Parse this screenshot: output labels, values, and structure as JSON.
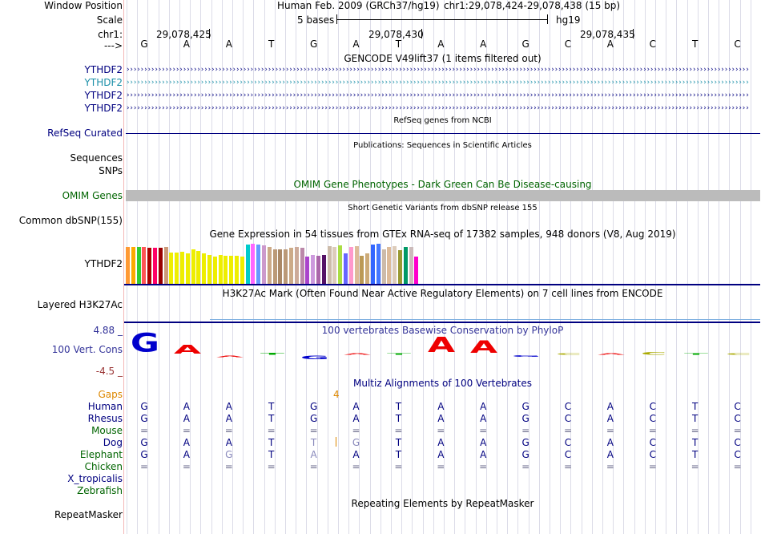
{
  "header": {
    "window_position_label": "Window Position",
    "assembly": "Human Feb. 2009 (GRCh37/hg19)",
    "range": "chr1:29,078,424-29,078,438 (15 bp)",
    "scale_label": "Scale",
    "scale_text": "5 bases",
    "db": "hg19",
    "chrom_label": "chr1:",
    "strand_label": "--->",
    "ticks": [
      "29,078,425",
      "29,078,430",
      "29,078,435"
    ]
  },
  "reference_bases": [
    "G",
    "A",
    "A",
    "T",
    "G",
    "A",
    "T",
    "A",
    "A",
    "G",
    "C",
    "A",
    "C",
    "T",
    "C"
  ],
  "gencode": {
    "title": "GENCODE V49lift37 (1 items filtered out)",
    "items": [
      "YTHDF2",
      "YTHDF2",
      "YTHDF2",
      "YTHDF2"
    ]
  },
  "refseq": {
    "title": "RefSeq genes from NCBI",
    "label": "RefSeq Curated"
  },
  "publications": {
    "title": "Publications: Sequences in Scientific Articles",
    "labels": [
      "Sequences",
      "SNPs"
    ]
  },
  "omim": {
    "title": "OMIM Gene Phenotypes - Dark Green Can Be Disease-causing",
    "label": "OMIM Genes"
  },
  "dbsnp": {
    "title": "Short Genetic Variants from dbSNP release 155",
    "label": "Common dbSNP(155)"
  },
  "gtex": {
    "title": "Gene Expression in 54 tissues from GTEx RNA-seq of 17382 samples, 948 donors (V8, Aug 2019)",
    "label": "YTHDF2",
    "bars": [
      {
        "color": "#ff9933",
        "value": 0.92
      },
      {
        "color": "#ffaa00",
        "value": 0.92
      },
      {
        "color": "#33cc33",
        "value": 0.92
      },
      {
        "color": "#ff5555",
        "value": 0.92
      },
      {
        "color": "#aa0000",
        "value": 0.9
      },
      {
        "color": "#ff0066",
        "value": 0.9
      },
      {
        "color": "#990000",
        "value": 0.9
      },
      {
        "color": "#cc9977",
        "value": 0.92
      },
      {
        "color": "#eeee00",
        "value": 0.78
      },
      {
        "color": "#eeee00",
        "value": 0.78
      },
      {
        "color": "#eeee00",
        "value": 0.8
      },
      {
        "color": "#eeee00",
        "value": 0.76
      },
      {
        "color": "#eeee00",
        "value": 0.86
      },
      {
        "color": "#eeee00",
        "value": 0.82
      },
      {
        "color": "#eeee00",
        "value": 0.76
      },
      {
        "color": "#eeee00",
        "value": 0.72
      },
      {
        "color": "#eeee00",
        "value": 0.68
      },
      {
        "color": "#eeee00",
        "value": 0.72
      },
      {
        "color": "#eeee00",
        "value": 0.7
      },
      {
        "color": "#eeee00",
        "value": 0.7
      },
      {
        "color": "#eeee00",
        "value": 0.7
      },
      {
        "color": "#eeee00",
        "value": 0.68
      },
      {
        "color": "#00cccc",
        "value": 0.98
      },
      {
        "color": "#ff66ff",
        "value": 1.0
      },
      {
        "color": "#6699ff",
        "value": 0.98
      },
      {
        "color": "#cc99cc",
        "value": 0.96
      },
      {
        "color": "#ccaa88",
        "value": 0.92
      },
      {
        "color": "#bb9977",
        "value": 0.86
      },
      {
        "color": "#aa8866",
        "value": 0.86
      },
      {
        "color": "#bb9977",
        "value": 0.86
      },
      {
        "color": "#ccaa88",
        "value": 0.9
      },
      {
        "color": "#ccaa99",
        "value": 0.92
      },
      {
        "color": "#bb88aa",
        "value": 0.9
      },
      {
        "color": "#aa44cc",
        "value": 0.68
      },
      {
        "color": "#cc99dd",
        "value": 0.72
      },
      {
        "color": "#aa66aa",
        "value": 0.7
      },
      {
        "color": "#551166",
        "value": 0.72
      },
      {
        "color": "#ccbbaa",
        "value": 0.94
      },
      {
        "color": "#ddccbb",
        "value": 0.92
      },
      {
        "color": "#aadd44",
        "value": 0.96
      },
      {
        "color": "#6666ff",
        "value": 0.76
      },
      {
        "color": "#ff99cc",
        "value": 0.92
      },
      {
        "color": "#ddbb99",
        "value": 0.94
      },
      {
        "color": "#bb9955",
        "value": 0.7
      },
      {
        "color": "#ccaa77",
        "value": 0.76
      },
      {
        "color": "#3366ff",
        "value": 0.98
      },
      {
        "color": "#4477ff",
        "value": 1.0
      },
      {
        "color": "#ccbbaa",
        "value": 0.86
      },
      {
        "color": "#ddbb99",
        "value": 0.92
      },
      {
        "color": "#ddccbb",
        "value": 0.94
      },
      {
        "color": "#999933",
        "value": 0.84
      },
      {
        "color": "#009966",
        "value": 0.92
      },
      {
        "color": "#ccbbbb",
        "value": 0.92
      },
      {
        "color": "#ff00cc",
        "value": 0.68
      }
    ]
  },
  "h3k27ac": {
    "title": "H3K27Ac Mark (Often Found Near Active Regulatory Elements) on 7 cell lines from ENCODE",
    "label": "Layered H3K27Ac"
  },
  "phylop": {
    "title": "100 vertebrates Basewise Conservation by PhyloP",
    "label": "100 Vert. Cons",
    "ymax": "4.88 _",
    "ymin": "-4.5 _",
    "scores": [
      4.2,
      2.0,
      -0.4,
      0.5,
      -0.8,
      0.2,
      0.0,
      3.5,
      2.8,
      -0.3,
      0.0,
      0.0,
      0.6,
      0.2,
      0.1
    ]
  },
  "multiz": {
    "title": "Multiz Alignments of 100 Vertebrates",
    "gaps_label": "Gaps",
    "gap_count": "4",
    "species": [
      {
        "name": "Human",
        "color": "#000080",
        "bases": [
          "G",
          "A",
          "A",
          "T",
          "G",
          "A",
          "T",
          "A",
          "A",
          "G",
          "C",
          "A",
          "C",
          "T",
          "C"
        ]
      },
      {
        "name": "Rhesus",
        "color": "#000080",
        "bases": [
          "G",
          "A",
          "A",
          "T",
          "G",
          "A",
          "T",
          "A",
          "A",
          "G",
          "C",
          "A",
          "C",
          "T",
          "C"
        ]
      },
      {
        "name": "Mouse",
        "color": "#006400",
        "bases": [
          "=",
          "=",
          "=",
          "=",
          "=",
          "=",
          "=",
          "=",
          "=",
          "=",
          "=",
          "=",
          "=",
          "=",
          "="
        ]
      },
      {
        "name": "Dog",
        "color": "#000080",
        "bases": [
          "G",
          "A",
          "A",
          "T",
          "T",
          "G",
          "T",
          "A",
          "A",
          "G",
          "C",
          "A",
          "C",
          "T",
          "C"
        ]
      },
      {
        "name": "Elephant",
        "color": "#006400",
        "bases": [
          "G",
          "A",
          "G",
          "T",
          "A",
          "A",
          "T",
          "A",
          "A",
          "G",
          "C",
          "A",
          "C",
          "T",
          "C"
        ]
      },
      {
        "name": "Chicken",
        "color": "#006400",
        "bases": [
          "=",
          "=",
          "=",
          "=",
          "=",
          "=",
          "=",
          "=",
          "=",
          "=",
          "=",
          "=",
          "=",
          "=",
          "="
        ]
      },
      {
        "name": "X_tropicalis",
        "color": "#000080",
        "bases": []
      },
      {
        "name": "Zebrafish",
        "color": "#006400",
        "bases": []
      }
    ]
  },
  "repeatmasker": {
    "title": "Repeating Elements by RepeatMasker",
    "label": "RepeatMasker"
  }
}
